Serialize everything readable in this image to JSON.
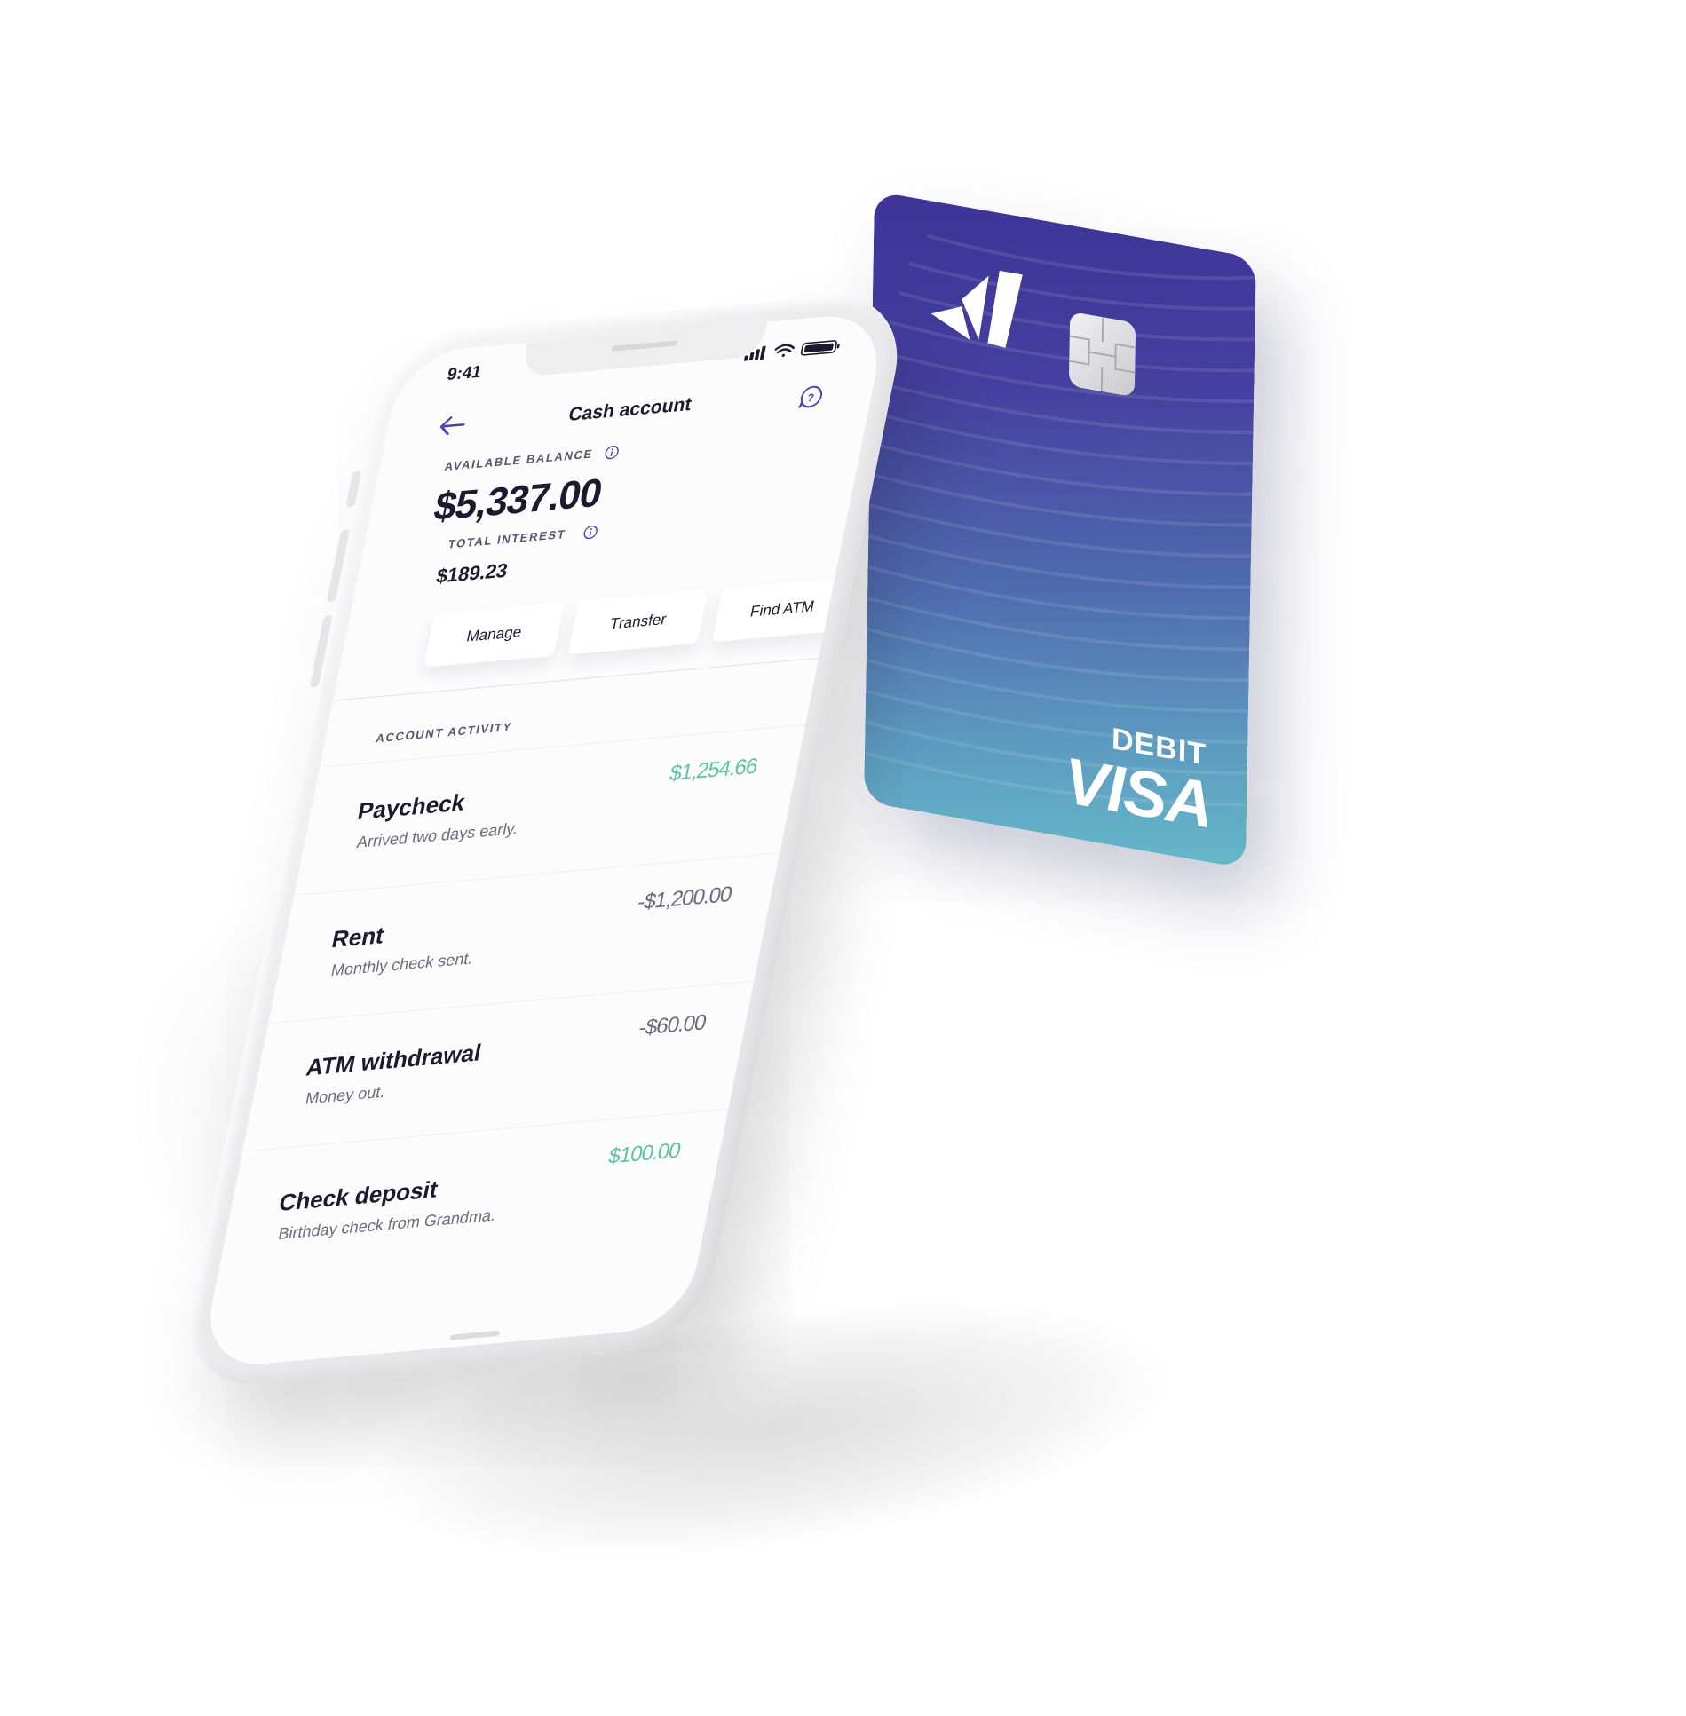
{
  "card": {
    "type_label": "DEBIT",
    "network_label": "VISA",
    "logo_icon": "brand-logo-icon",
    "chip_icon": "chip-icon",
    "colors": {
      "top": "#3d3496",
      "bottom": "#66b8c9"
    }
  },
  "phone": {
    "status_bar": {
      "time": "9:41",
      "icons": [
        "signal-icon",
        "wifi-icon",
        "battery-icon"
      ]
    },
    "nav": {
      "back_icon": "back-arrow-icon",
      "title": "Cash account",
      "help_icon": "help-chat-icon"
    },
    "balance": {
      "label": "AVAILABLE BALANCE",
      "value": "$5,337.00"
    },
    "interest": {
      "label": "TOTAL INTEREST",
      "value": "$189.23"
    },
    "actions": [
      {
        "label": "Manage"
      },
      {
        "label": "Transfer"
      },
      {
        "label": "Find ATM"
      }
    ],
    "activity": {
      "label": "ACCOUNT ACTIVITY",
      "transactions": [
        {
          "title": "Paycheck",
          "subtitle": "Arrived two days early.",
          "amount": "$1,254.66",
          "direction": "in"
        },
        {
          "title": "Rent",
          "subtitle": "Monthly check sent.",
          "amount": "-$1,200.00",
          "direction": "out"
        },
        {
          "title": "ATM withdrawal",
          "subtitle": "Money out.",
          "amount": "-$60.00",
          "direction": "out"
        },
        {
          "title": "Check deposit",
          "subtitle": "Birthday check from Grandma.",
          "amount": "$100.00",
          "direction": "in"
        }
      ]
    },
    "colors": {
      "accent": "#4b44b5",
      "positive": "#5cc4a3",
      "text": "#1c1b2e",
      "muted": "#6b6b7e"
    }
  }
}
